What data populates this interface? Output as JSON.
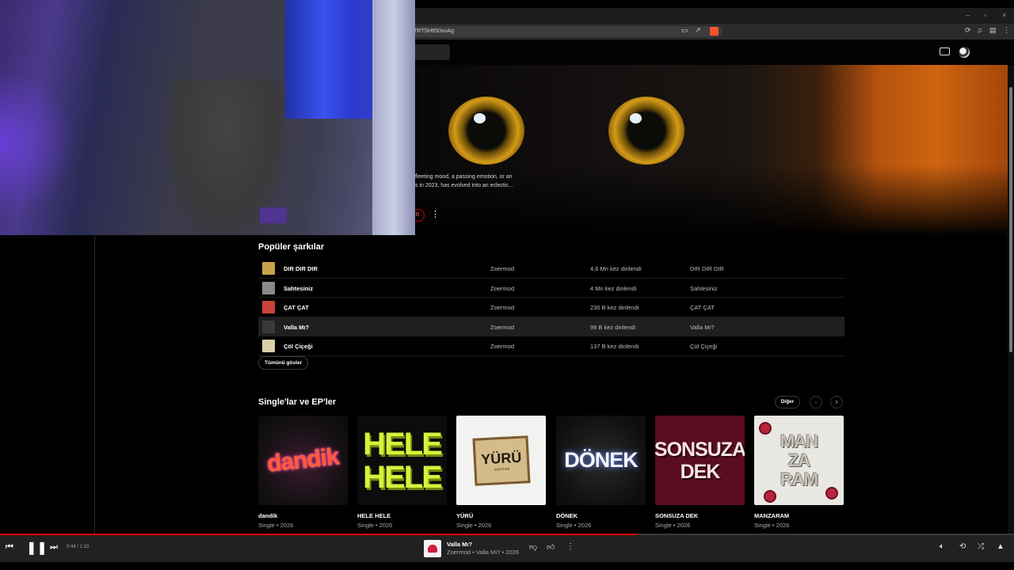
{
  "browser": {
    "url_fragment": "TRTSH650xuAg",
    "window_controls": [
      "–",
      "▫",
      "×"
    ]
  },
  "hero": {
    "description_line1": "fleeting mood, a passing emotion, or an",
    "description_line2": "s in 2023, has evolved into an eclectic...",
    "subscribe_fragment": "B",
    "more_label": "⋮"
  },
  "popular": {
    "title": "Popüler şarkılar",
    "songs": [
      {
        "title": "DIR DIR DIR",
        "artist": "Zoermod",
        "plays": "4,6 Mn kez dinlendi",
        "album": "DIR DIR DIR",
        "thumb_color": "#c9a34a"
      },
      {
        "title": "Sahtesiniz",
        "artist": "Zoermod",
        "plays": "4 Mn kez dinlendi",
        "album": "Sahtesiniz",
        "thumb_color": "#8a8a8a"
      },
      {
        "title": "ÇAT ÇAT",
        "artist": "Zoermod",
        "plays": "230 B kez dinlendi",
        "album": "ÇAT ÇAT",
        "thumb_color": "#c8433a"
      },
      {
        "title": "Valla Mı?",
        "artist": "Zoermod",
        "plays": "99 B kez dinlendi",
        "album": "Valla Mı?",
        "thumb_color": "#3a3a3a"
      },
      {
        "title": "Çöl Çiçeği",
        "artist": "Zoermod",
        "plays": "137 B kez dinlendi",
        "album": "Çöl Çiçeği",
        "thumb_color": "#d9cfa8"
      }
    ],
    "show_all": "Tümünü göster"
  },
  "singles": {
    "title": "Single'lar ve EP'ler",
    "more": "Diğer",
    "prev": "‹",
    "next": "›",
    "items": [
      {
        "title": "dandik",
        "subtitle": "Single • 2026",
        "art": "dandik"
      },
      {
        "title": "HELE HELE",
        "subtitle": "Single • 2026",
        "art_lines": [
          "HELE",
          "HELE"
        ]
      },
      {
        "title": "YÜRÜ",
        "subtitle": "Single • 2026",
        "art": "YÜRÜ",
        "art_sub": "zoermod"
      },
      {
        "title": "DÖNEK",
        "subtitle": "Single • 2026",
        "art": "DÖNEK"
      },
      {
        "title": "SONSUZA DEK",
        "subtitle": "Single • 2026",
        "art_lines": [
          "SONSUZA",
          "DEK"
        ]
      },
      {
        "title": "MANZARAM",
        "subtitle": "Single • 2026",
        "art_lines": [
          "MAN",
          "ZA",
          "RAM"
        ]
      }
    ]
  },
  "player": {
    "time": "0:44 / 1:10",
    "progress": 0.628,
    "now_playing_title": "Valla Mı?",
    "now_playing_sub": "Zoermod • Valla Mı? • 2026",
    "accent_color": "#ff0000"
  }
}
